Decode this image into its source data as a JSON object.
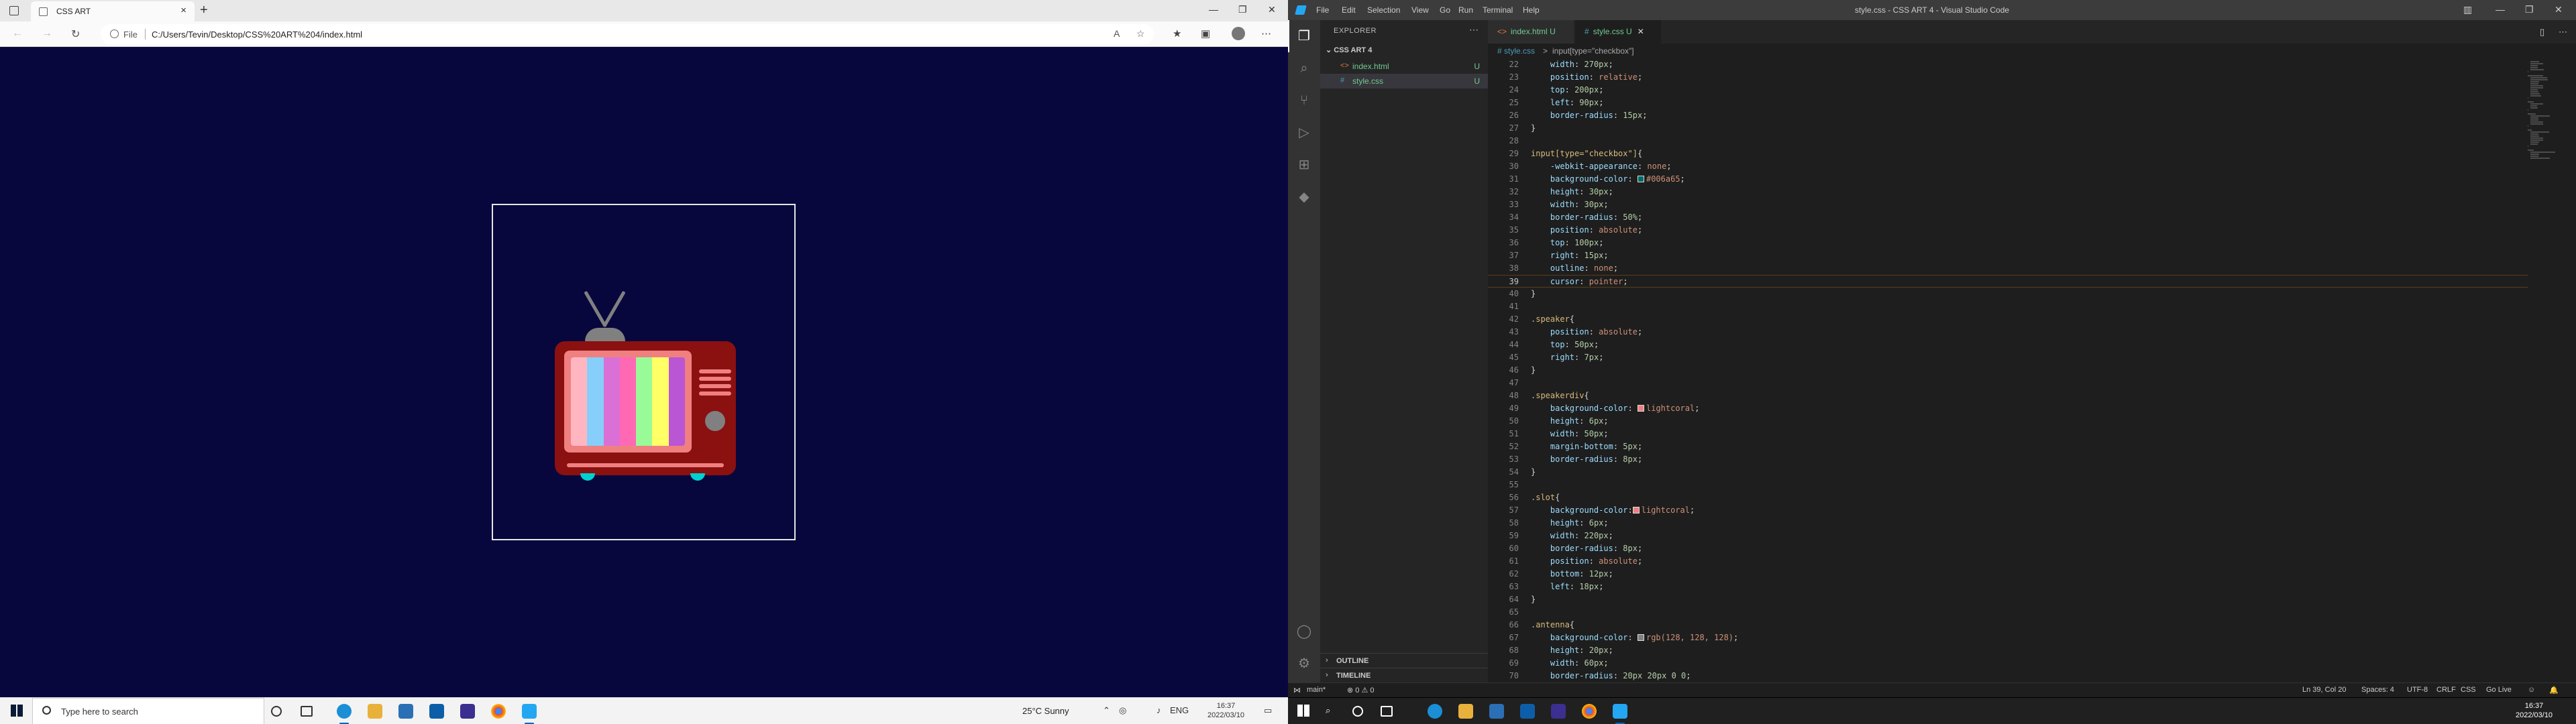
{
  "browser": {
    "tab_title": "CSS ART",
    "url_scheme": "File",
    "url": "C:/Users/Tevin/Desktop/CSS%20ART%204/index.html",
    "tv": {
      "bar_colors": [
        "#ffb6c1",
        "#87cefa",
        "#da70d6",
        "#ff69b4",
        "#98fb98",
        "#ffff66",
        "#ba55d3"
      ]
    }
  },
  "taskbar_left": {
    "search_placeholder": "Type here to search",
    "weather": "25°C  Sunny",
    "lang": "ENG",
    "time": "16:37",
    "date": "2022/03/10"
  },
  "vscode": {
    "window_title": "style.css - CSS ART 4 - Visual Studio Code",
    "menu": [
      "File",
      "Edit",
      "Selection",
      "View",
      "Go",
      "Run",
      "Terminal",
      "Help"
    ],
    "explorer_title": "EXPLORER",
    "folder_name": "CSS ART 4",
    "files": [
      {
        "name": "index.html",
        "badge": "U",
        "icon": "<>"
      },
      {
        "name": "style.css",
        "badge": "U",
        "icon": "#"
      }
    ],
    "outline_label": "OUTLINE",
    "timeline_label": "TIMELINE",
    "tabs": [
      {
        "label": "index.html",
        "badge": "U",
        "icon": "<>"
      },
      {
        "label": "style.css",
        "badge": "U",
        "icon": "#"
      }
    ],
    "breadcrumb": [
      "# style.css",
      ">",
      "input[type=\"checkbox\"]"
    ],
    "cursor_line": 39,
    "code": [
      {
        "n": 22,
        "t": "    width: 270px;"
      },
      {
        "n": 23,
        "t": "    position: relative;"
      },
      {
        "n": 24,
        "t": "    top: 200px;"
      },
      {
        "n": 25,
        "t": "    left: 90px;"
      },
      {
        "n": 26,
        "t": "    border-radius: 15px;"
      },
      {
        "n": 27,
        "t": "}"
      },
      {
        "n": 28,
        "t": ""
      },
      {
        "n": 29,
        "t": "input[type=\"checkbox\"]{"
      },
      {
        "n": 30,
        "t": "    -webkit-appearance: none;"
      },
      {
        "n": 31,
        "t": "    background-color: #006a65;",
        "sw": "#006a65"
      },
      {
        "n": 32,
        "t": "    height: 30px;"
      },
      {
        "n": 33,
        "t": "    width: 30px;"
      },
      {
        "n": 34,
        "t": "    border-radius: 50%;"
      },
      {
        "n": 35,
        "t": "    position: absolute;"
      },
      {
        "n": 36,
        "t": "    top: 100px;"
      },
      {
        "n": 37,
        "t": "    right: 15px;"
      },
      {
        "n": 38,
        "t": "    outline: none;"
      },
      {
        "n": 39,
        "t": "    cursor: pointer;"
      },
      {
        "n": 40,
        "t": "}"
      },
      {
        "n": 41,
        "t": ""
      },
      {
        "n": 42,
        "t": ".speaker{"
      },
      {
        "n": 43,
        "t": "    position: absolute;"
      },
      {
        "n": 44,
        "t": "    top: 50px;"
      },
      {
        "n": 45,
        "t": "    right: 7px;"
      },
      {
        "n": 46,
        "t": "}"
      },
      {
        "n": 47,
        "t": ""
      },
      {
        "n": 48,
        "t": ".speakerdiv{"
      },
      {
        "n": 49,
        "t": "    background-color: lightcoral;",
        "sw": "#f08080"
      },
      {
        "n": 50,
        "t": "    height: 6px;"
      },
      {
        "n": 51,
        "t": "    width: 50px;"
      },
      {
        "n": 52,
        "t": "    margin-bottom: 5px;"
      },
      {
        "n": 53,
        "t": "    border-radius: 8px;"
      },
      {
        "n": 54,
        "t": "}"
      },
      {
        "n": 55,
        "t": ""
      },
      {
        "n": 56,
        "t": ".slot{"
      },
      {
        "n": 57,
        "t": "    background-color:lightcoral;",
        "sw": "#f08080"
      },
      {
        "n": 58,
        "t": "    height: 6px;"
      },
      {
        "n": 59,
        "t": "    width: 220px;"
      },
      {
        "n": 60,
        "t": "    border-radius: 8px;"
      },
      {
        "n": 61,
        "t": "    position: absolute;"
      },
      {
        "n": 62,
        "t": "    bottom: 12px;"
      },
      {
        "n": 63,
        "t": "    left: 18px;"
      },
      {
        "n": 64,
        "t": "}"
      },
      {
        "n": 65,
        "t": ""
      },
      {
        "n": 66,
        "t": ".antenna{"
      },
      {
        "n": 67,
        "t": "    background-color: rgb(128, 128, 128);",
        "sw": "#808080"
      },
      {
        "n": 68,
        "t": "    height: 20px;"
      },
      {
        "n": 69,
        "t": "    width: 60px;"
      },
      {
        "n": 70,
        "t": "    border-radius: 20px 20px 0 0;"
      }
    ],
    "status": {
      "branch": "main*",
      "problems": "⊗ 0 ⚠ 0",
      "position": "Ln 39, Col 20",
      "spaces": "Spaces: 4",
      "encoding": "UTF-8",
      "eol": "CRLF",
      "language": "CSS",
      "golive": "Go Live"
    }
  },
  "taskbar_right": {
    "time": "16:37",
    "date": "2022/03/10"
  }
}
